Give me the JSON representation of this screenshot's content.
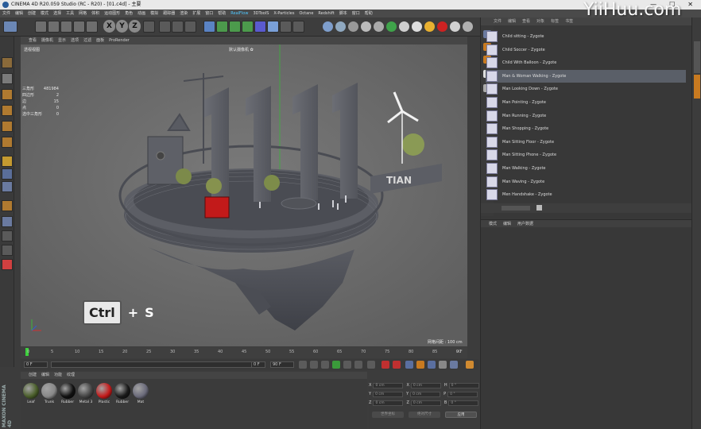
{
  "window": {
    "title": "CINEMA 4D R20.059 Studio (RC - R20) - [01.c4d] - 主要",
    "buttons": [
      "—",
      "☐",
      "✕"
    ]
  },
  "watermark": "YiiHuu.com",
  "menubar": {
    "items": [
      "文件",
      "编辑",
      "创建",
      "模式",
      "选择",
      "工具",
      "网格",
      "体积",
      "运动图形",
      "角色",
      "动画",
      "模拟",
      "跟踪器",
      "渲染",
      "扩展",
      "窗口",
      "帮助",
      "RealFlow",
      "3DToolS",
      "X-Particles",
      "Octane",
      "Redshift",
      "脚本",
      "窗口",
      "帮助"
    ]
  },
  "viewport": {
    "menu": [
      "查看",
      "摄像机",
      "显示",
      "选项",
      "过滤",
      "面板",
      "ProRender"
    ],
    "label": "透视视图",
    "camera_label": "默认摄像机 ✿",
    "stats": [
      {
        "k": "三角形",
        "v": "481984"
      },
      {
        "k": "四边形",
        "v": "2"
      },
      {
        "k": "边",
        "v": "15"
      },
      {
        "k": "点",
        "v": "0"
      },
      {
        "k": "选中三角形",
        "v": "0"
      }
    ],
    "grid_spacing": "网格间距 : 100 cm",
    "shortcut": {
      "key": "Ctrl",
      "plus": "+",
      "letter": "S"
    }
  },
  "timeline": {
    "ticks": [
      "0",
      "5",
      "10",
      "15",
      "20",
      "25",
      "30",
      "35",
      "40",
      "45",
      "50",
      "55",
      "60",
      "65",
      "70",
      "75",
      "80",
      "85",
      "90"
    ],
    "end_label": "0 F"
  },
  "transport": {
    "start": "0 F",
    "current": "0 F",
    "end": "90 F",
    "end2": "90 F"
  },
  "materials": {
    "menu": [
      "创建",
      "编辑",
      "功能",
      "纹理"
    ],
    "items": [
      {
        "name": "Leaf",
        "color": "#4a5e2a"
      },
      {
        "name": "Trunk",
        "color": "#888888"
      },
      {
        "name": "Rubber",
        "color": "#111111"
      },
      {
        "name": "Metal 3",
        "color": "#444444"
      },
      {
        "name": "Plastic",
        "color": "#c41a1a"
      },
      {
        "name": "Rubber",
        "color": "#1a1a1a"
      },
      {
        "name": "Mat",
        "color": "#6a6a7a"
      }
    ]
  },
  "coords": {
    "rows": [
      {
        "a": "X",
        "av": "0 cm",
        "b": "X",
        "bv": "0 cm",
        "c": "H",
        "cv": "0 °"
      },
      {
        "a": "Y",
        "av": "0 cm",
        "b": "Y",
        "bv": "0 cm",
        "c": "P",
        "cv": "0 °"
      },
      {
        "a": "Z",
        "av": "0 cm",
        "b": "Z",
        "bv": "0 cm",
        "c": "B",
        "cv": "0 °"
      }
    ],
    "mode1": "世界坐标",
    "mode2": "绝对尺寸",
    "apply": "应用"
  },
  "object_manager": {
    "menu": [
      "文件",
      "编辑",
      "查看",
      "对象",
      "标签",
      "书签"
    ],
    "items": [
      {
        "name": "Child sitting - Zygote",
        "selected": false
      },
      {
        "name": "Child Soccer - Zygote",
        "selected": false
      },
      {
        "name": "Child With Balloon - Zygote",
        "selected": false
      },
      {
        "name": "Man & Woman Walking - Zygote",
        "selected": true
      },
      {
        "name": "Man Looking Down - Zygote",
        "selected": false
      },
      {
        "name": "Man Pointing - Zygote",
        "selected": false
      },
      {
        "name": "Man Running - Zygote",
        "selected": false
      },
      {
        "name": "Man Shopping - Zygote",
        "selected": false
      },
      {
        "name": "Man Sitting Floor - Zygote",
        "selected": false
      },
      {
        "name": "Man Sitting Phone - Zygote",
        "selected": false
      },
      {
        "name": "Man Walking - Zygote",
        "selected": false
      },
      {
        "name": "Man Waving - Zygote",
        "selected": false
      },
      {
        "name": "Men Handshake - Zygote",
        "selected": false
      }
    ]
  },
  "attributes": {
    "menu": [
      "模式",
      "编辑",
      "用户数据"
    ]
  },
  "scene": {
    "sign_text": "TIAN"
  },
  "colors": {
    "accent": "#4fc7ff",
    "selection": "#5a5f68"
  }
}
